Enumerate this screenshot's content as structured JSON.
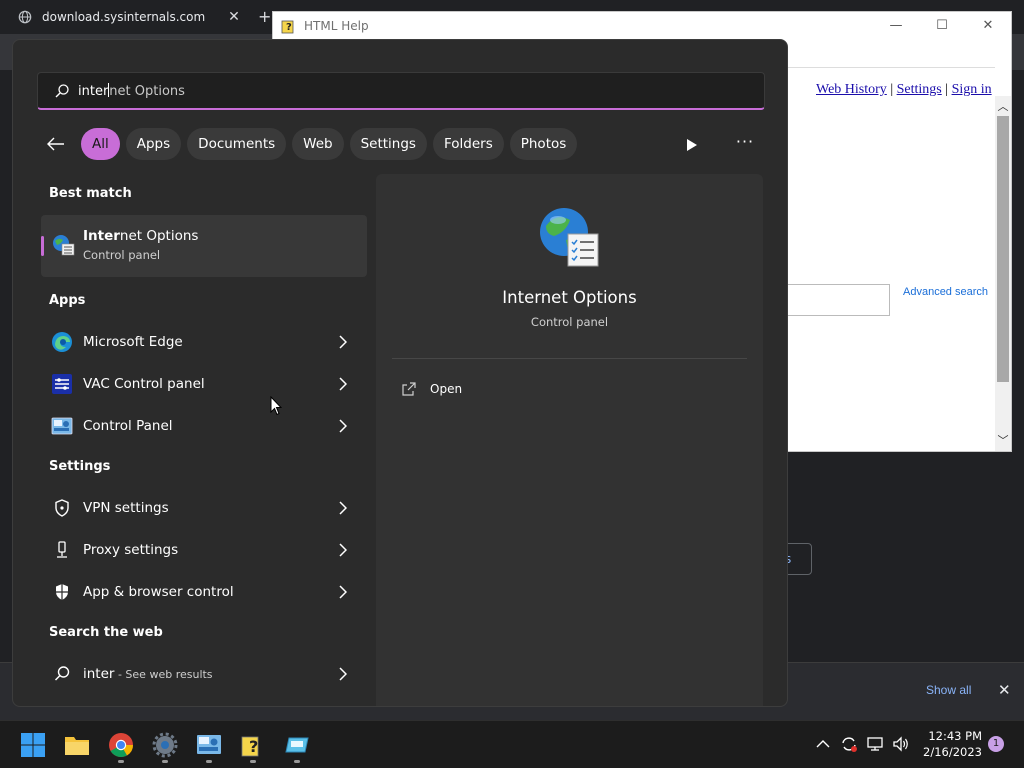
{
  "browser": {
    "tab_title": "download.sysinternals.com",
    "tab_close": "✕",
    "new_tab": "+",
    "show_all": "Show all",
    "download_close": "✕",
    "partial_button": "s"
  },
  "help_window": {
    "title": "HTML Help",
    "links": {
      "web_history": "Web History",
      "settings": "Settings",
      "sign_in": "Sign in",
      "sep": "|"
    },
    "advanced_search": "Advanced search",
    "scroll_up": "︿",
    "scroll_down": "﹀"
  },
  "search": {
    "query_typed": "inter",
    "query_suggest": "net Options",
    "filters": [
      "All",
      "Apps",
      "Documents",
      "Web",
      "Settings",
      "Folders",
      "Photos"
    ],
    "active_filter": "All",
    "more": "···",
    "sections": {
      "best_match": "Best match",
      "apps": "Apps",
      "settings": "Settings",
      "web": "Search the web"
    },
    "best_match": {
      "name_bold": "Inter",
      "name_rest": "net Options",
      "subtitle": "Control panel"
    },
    "apps": [
      {
        "label": "Microsoft Edge",
        "icon": "edge-icon"
      },
      {
        "label": "VAC Control panel",
        "icon": "vac-icon"
      },
      {
        "label": "Control Panel",
        "icon": "control-panel-icon"
      }
    ],
    "settings": [
      {
        "label": "VPN settings",
        "icon": "shield-icon"
      },
      {
        "label": "Proxy settings",
        "icon": "proxy-icon"
      },
      {
        "label": "App & browser control",
        "icon": "shield-filled-icon"
      }
    ],
    "web": {
      "term": "inter",
      "hint": " - See web results"
    },
    "preview": {
      "title": "Internet Options",
      "subtitle": "Control panel",
      "open": "Open"
    }
  },
  "taskbar": {
    "time": "12:43 PM",
    "date": "2/16/2023",
    "notifications": "1"
  },
  "colors": {
    "accent": "#c86dd7",
    "flyout_bg": "#2b2b2b",
    "preview_bg": "#323232"
  }
}
